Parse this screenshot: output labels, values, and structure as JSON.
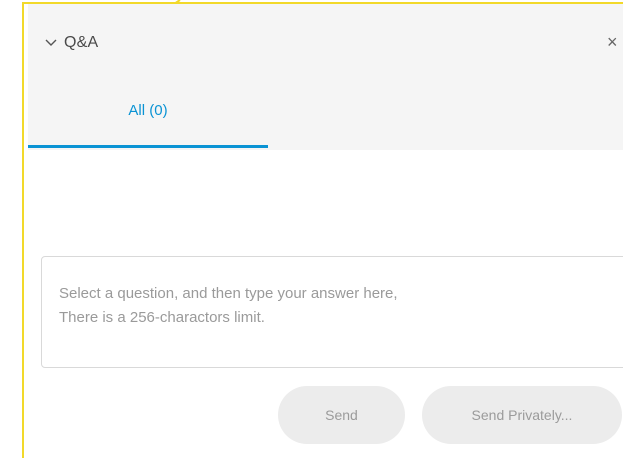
{
  "panel": {
    "title": "Q&A",
    "close_glyph": "×",
    "chevron_icon": "chevron-down-icon"
  },
  "tabs": [
    {
      "label": "All (0)",
      "active": true
    }
  ],
  "answer_box": {
    "placeholder_line1": "Select a question, and then type your answer here,",
    "placeholder_line2": "There is a 256-charactors limit."
  },
  "buttons": {
    "send_label": "Send",
    "send_private_label": "Send Privately..."
  },
  "colors": {
    "accent": "#0a93d4",
    "highlight": "#f2d92a",
    "header_bg": "#f5f5f5",
    "button_bg": "#ececec",
    "placeholder_text": "#9a9a9a"
  }
}
